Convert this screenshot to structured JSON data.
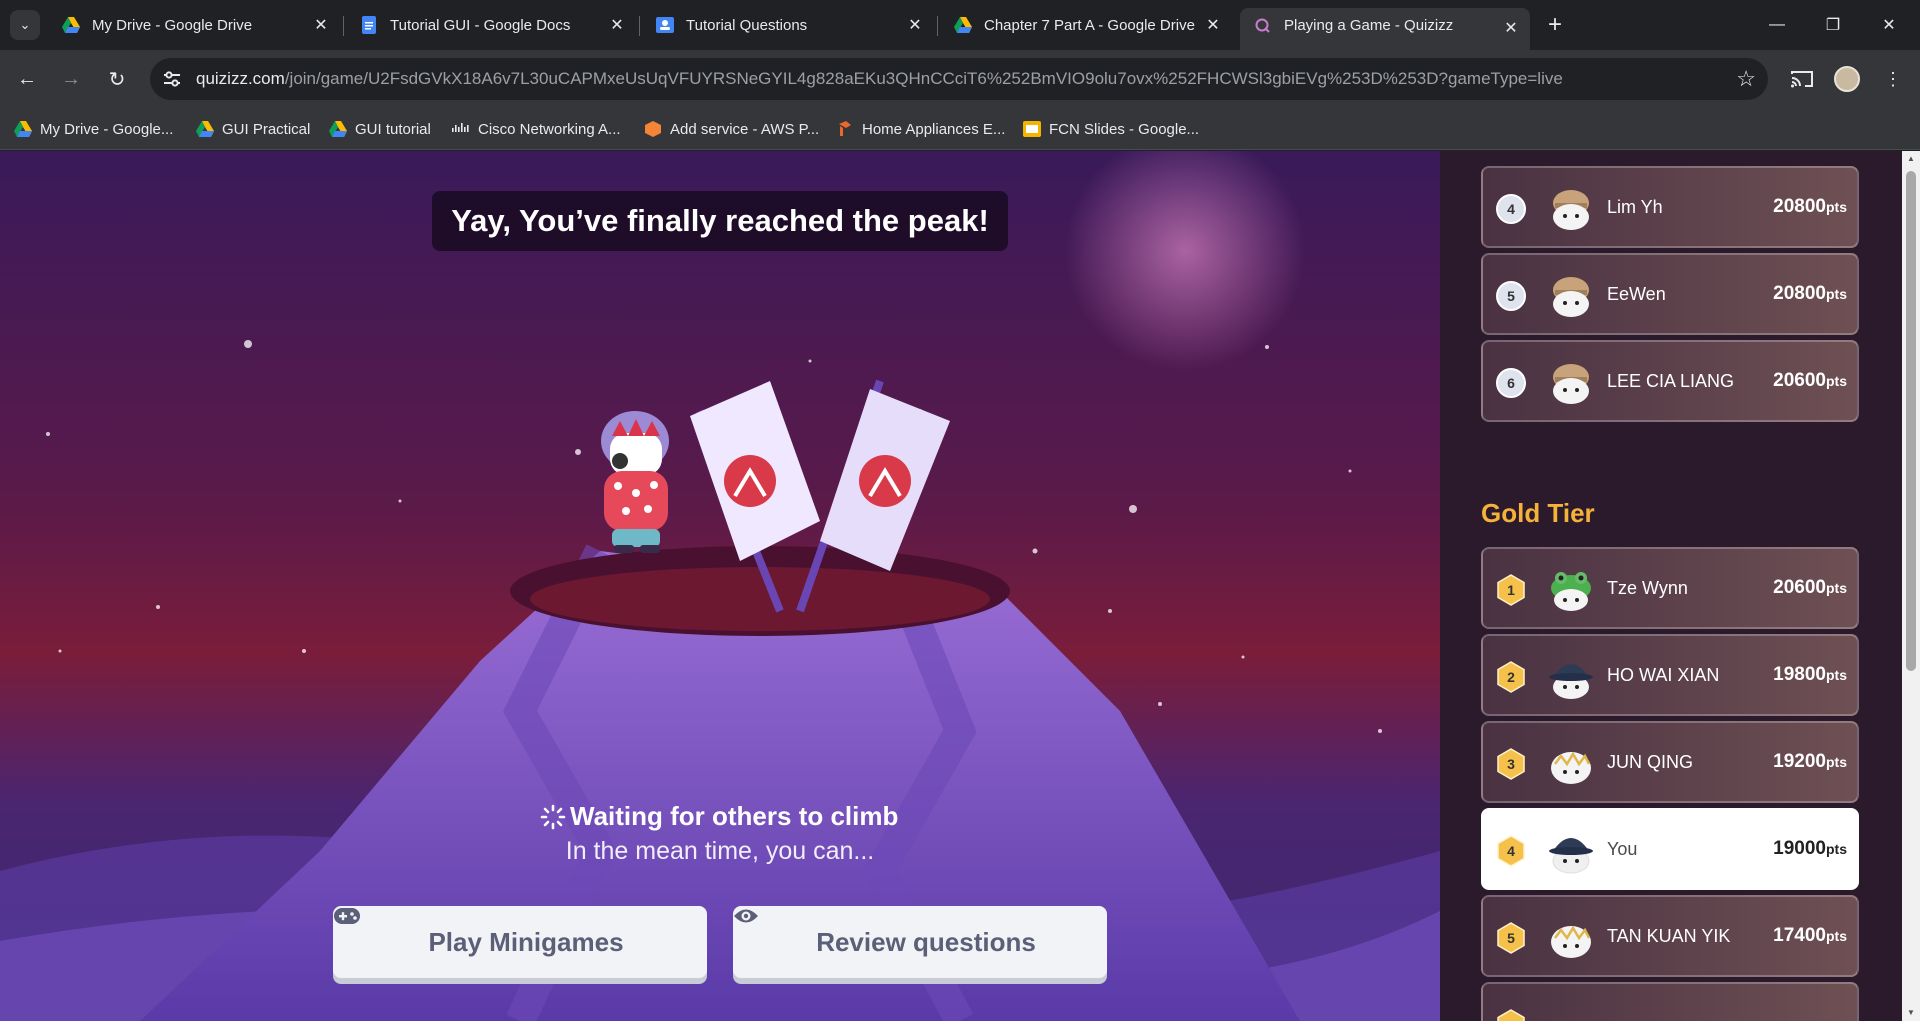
{
  "browser": {
    "tabs": [
      {
        "title": "My Drive - Google Drive",
        "icon": "google-drive-icon",
        "active": false
      },
      {
        "title": "Tutorial GUI - Google Docs",
        "icon": "google-docs-icon",
        "active": false
      },
      {
        "title": "Tutorial Questions",
        "icon": "classroom-icon",
        "active": false
      },
      {
        "title": "Chapter 7 Part A - Google Drive",
        "icon": "google-drive-icon",
        "active": false
      },
      {
        "title": "Playing a Game - Quizizz",
        "icon": "quizizz-icon",
        "active": true
      }
    ],
    "url_host": "quizizz.com",
    "url_path": "/join/game/U2FsdGVkX18A6v7L30uCAPMxeUsUqVFUYRSNeGYIL4g828aEKu3QHnCCciT6%252BmVIO9olu7ovx%252FHCWSl3gbiEVg%253D%253D?gameType=live",
    "bookmarks": [
      {
        "label": "My Drive - Google...",
        "icon": "google-drive-icon"
      },
      {
        "label": "GUI Practical",
        "icon": "google-drive-icon"
      },
      {
        "label": "GUI tutorial",
        "icon": "google-drive-icon"
      },
      {
        "label": "Cisco Networking A...",
        "icon": "cisco-icon"
      },
      {
        "label": "Add service - AWS P...",
        "icon": "aws-icon"
      },
      {
        "label": "Home Appliances E...",
        "icon": "appliance-store-icon"
      },
      {
        "label": "FCN Slides - Google...",
        "icon": "google-slides-icon"
      }
    ]
  },
  "game": {
    "banner": "Yay, You’ve finally reached the peak!",
    "waiting_title": "Waiting for others to climb",
    "waiting_sub": "In the mean time, you can...",
    "play_label": "Play Minigames",
    "review_label": "Review questions"
  },
  "leaderboard": {
    "top_tier": [
      {
        "rank": "4",
        "name": "Lim Yh",
        "points": "20800",
        "avatar": "beanie-avatar"
      },
      {
        "rank": "5",
        "name": "EeWen",
        "points": "20800",
        "avatar": "beanie-avatar"
      },
      {
        "rank": "6",
        "name": "LEE CIA LIANG",
        "points": "20600",
        "avatar": "beanie-avatar"
      }
    ],
    "gold_tier_label": "Gold Tier",
    "gold_tier": [
      {
        "rank": "1",
        "name": "Tze Wynn",
        "points": "20600",
        "avatar": "frog-avatar",
        "you": false
      },
      {
        "rank": "2",
        "name": "HO WAI XIAN",
        "points": "19800",
        "avatar": "bucket-hat-avatar",
        "you": false
      },
      {
        "rank": "3",
        "name": "JUN QING",
        "points": "19200",
        "avatar": "crown-avatar",
        "you": false
      },
      {
        "rank": "4",
        "name": "You",
        "points": "19000",
        "avatar": "bucket-hat-avatar",
        "you": true
      },
      {
        "rank": "5",
        "name": "TAN KUAN YIK",
        "points": "17400",
        "avatar": "crown-avatar",
        "you": false
      }
    ],
    "pts_suffix": "pts"
  },
  "colors": {
    "gold": "#f4b23a",
    "silver_badge": "#dfe3ee",
    "gold_badge": "#f6c14a"
  }
}
